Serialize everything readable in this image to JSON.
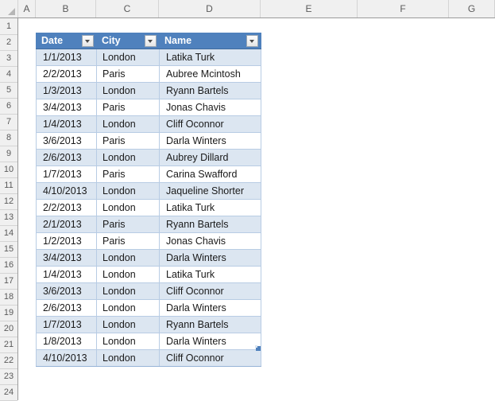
{
  "grid": {
    "column_headers": [
      "A",
      "B",
      "C",
      "D",
      "E",
      "F",
      "G"
    ],
    "row_headers": [
      "1",
      "2",
      "3",
      "4",
      "5",
      "6",
      "7",
      "8",
      "9",
      "10",
      "11",
      "12",
      "13",
      "14",
      "15",
      "16",
      "17",
      "18",
      "19",
      "20",
      "21",
      "22",
      "23",
      "24"
    ],
    "select_all_icon": "select-all-triangle-icon"
  },
  "table": {
    "header_fill": "#4F81BD",
    "band_fill": "#DCE6F1",
    "border_color": "#B8CCE4",
    "columns": [
      {
        "label": "Date",
        "filter_icon": "filter-dropdown-icon"
      },
      {
        "label": "City",
        "filter_icon": "filter-dropdown-icon"
      },
      {
        "label": "Name",
        "filter_icon": "filter-dropdown-icon"
      }
    ],
    "rows": [
      {
        "date": "1/1/2013",
        "city": "London",
        "name": "Latika Turk"
      },
      {
        "date": "2/2/2013",
        "city": "Paris",
        "name": "Aubree Mcintosh"
      },
      {
        "date": "1/3/2013",
        "city": "London",
        "name": "Ryann Bartels"
      },
      {
        "date": "3/4/2013",
        "city": "Paris",
        "name": "Jonas Chavis"
      },
      {
        "date": "1/4/2013",
        "city": "London",
        "name": "Cliff Oconnor"
      },
      {
        "date": "3/6/2013",
        "city": "Paris",
        "name": "Darla Winters"
      },
      {
        "date": "2/6/2013",
        "city": "London",
        "name": "Aubrey Dillard"
      },
      {
        "date": "1/7/2013",
        "city": "Paris",
        "name": "Carina Swafford"
      },
      {
        "date": "4/10/2013",
        "city": "London",
        "name": "Jaqueline Shorter"
      },
      {
        "date": "2/2/2013",
        "city": "London",
        "name": "Latika Turk"
      },
      {
        "date": "2/1/2013",
        "city": "Paris",
        "name": "Ryann Bartels"
      },
      {
        "date": "1/2/2013",
        "city": "Paris",
        "name": "Jonas Chavis"
      },
      {
        "date": "3/4/2013",
        "city": "London",
        "name": "Darla Winters"
      },
      {
        "date": "1/4/2013",
        "city": "London",
        "name": "Latika Turk"
      },
      {
        "date": "3/6/2013",
        "city": "London",
        "name": "Cliff Oconnor"
      },
      {
        "date": "2/6/2013",
        "city": "London",
        "name": "Darla Winters"
      },
      {
        "date": "1/7/2013",
        "city": "London",
        "name": "Ryann Bartels"
      },
      {
        "date": "1/8/2013",
        "city": "London",
        "name": "Darla Winters"
      },
      {
        "date": "4/10/2013",
        "city": "London",
        "name": "Cliff Oconnor"
      }
    ],
    "resize_handle_icon": "table-resize-handle-icon"
  }
}
